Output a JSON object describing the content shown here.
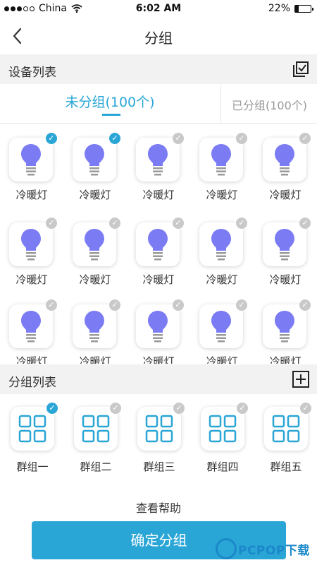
{
  "status_bar": {
    "carrier": "China",
    "time": "6:02 AM",
    "battery": "22%",
    "battery_level": 0.22
  },
  "nav": {
    "title": "分组",
    "back_icon": "chevron-left-icon"
  },
  "device_section": {
    "title": "设备列表",
    "action_icon": "select-all-icon"
  },
  "tabs": {
    "active": "未分组(100个)",
    "inactive": "已分组(100个)"
  },
  "devices": [
    {
      "label": "冷暖灯",
      "checked": true
    },
    {
      "label": "冷暖灯",
      "checked": true
    },
    {
      "label": "冷暖灯",
      "checked": false
    },
    {
      "label": "冷暖灯",
      "checked": false
    },
    {
      "label": "冷暖灯",
      "checked": false
    },
    {
      "label": "冷暖灯",
      "checked": false
    },
    {
      "label": "冷暖灯",
      "checked": false
    },
    {
      "label": "冷暖灯",
      "checked": false
    },
    {
      "label": "冷暖灯",
      "checked": false
    },
    {
      "label": "冷暖灯",
      "checked": false
    },
    {
      "label": "冷暖灯",
      "checked": false
    },
    {
      "label": "冷暖灯",
      "checked": false
    },
    {
      "label": "冷暖灯",
      "checked": false
    },
    {
      "label": "冷暖灯",
      "checked": false
    },
    {
      "label": "冷暖灯",
      "checked": false
    }
  ],
  "group_section": {
    "title": "分组列表",
    "action_icon": "add-group-icon"
  },
  "groups": [
    {
      "label": "群组一",
      "checked": true
    },
    {
      "label": "群组二",
      "checked": false
    },
    {
      "label": "群组三",
      "checked": false
    },
    {
      "label": "群组四",
      "checked": false
    },
    {
      "label": "群组五",
      "checked": false
    }
  ],
  "help_link": "查看帮助",
  "confirm_button": "确定分组",
  "watermark": "PCPOP下载",
  "colors": {
    "accent": "#2aa6d6",
    "bulb": "#7b7cf4",
    "check_off": "#c9c9c9"
  }
}
